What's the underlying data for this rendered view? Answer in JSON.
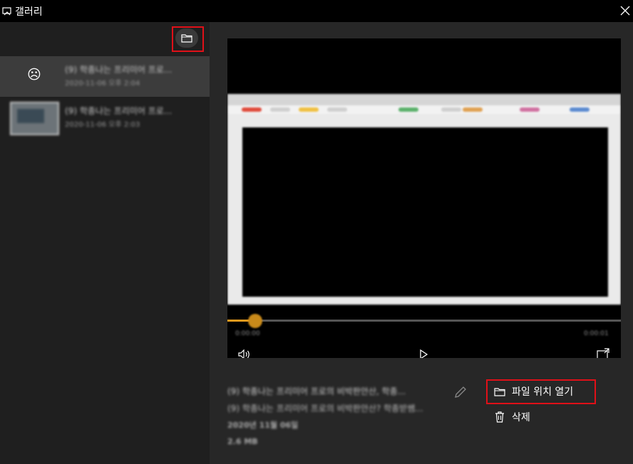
{
  "window": {
    "title": "갤러리",
    "app_icon": "gallery-icon",
    "close_icon": "close-icon"
  },
  "sidebar": {
    "open_folder_icon": "folder-icon",
    "items": [
      {
        "title": "(9) 학종나는 프리미어 프로...",
        "meta": "2020-11-06 오후 2:04",
        "thumbnail": "sad-face-icon",
        "selected": true
      },
      {
        "title": "(9) 학종나는 프리미어 프로...",
        "meta": "2020-11-06 오후 2:03",
        "thumbnail": "video-thumbnail",
        "selected": false
      }
    ]
  },
  "player": {
    "time_current": "0:00:00",
    "time_total": "0:00:01",
    "progress_fraction": 0.07,
    "volume_icon": "volume-icon",
    "play_icon": "play-icon",
    "fullscreen_icon": "fullscreen-icon"
  },
  "details": {
    "title": "(9) 학종나는 프리미어 프로의 비박판안산, 학종...",
    "subtitle": "(9) 학종나는 프리미어 프로의 비박판안산? 학종받쌤...",
    "date": "2020년 11월 06일",
    "size": "2.6 MB",
    "edit_icon": "pencil-icon"
  },
  "actions": {
    "open_location_label": "파일 위치 열기",
    "open_location_icon": "folder-icon",
    "delete_label": "삭제",
    "delete_icon": "trash-icon"
  },
  "colors": {
    "highlight": "#e01018",
    "accent_orange": "#e79a1d",
    "sidebar_bg": "#1f1f1f",
    "detail_bg": "#272727",
    "selected_bg": "#3c3c3c"
  }
}
